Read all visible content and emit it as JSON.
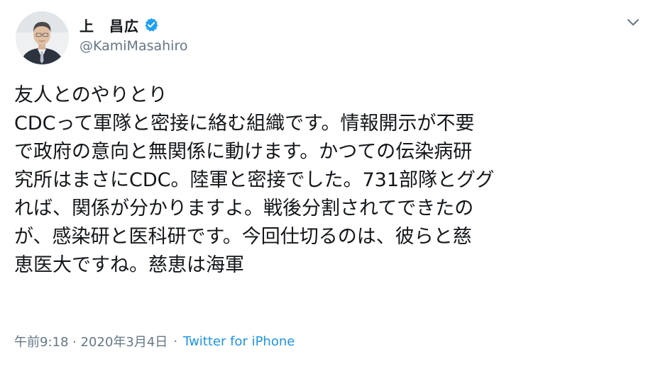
{
  "author": {
    "display_name": "上　昌広",
    "handle": "@KamiMasahiro",
    "verified": true
  },
  "tweet": {
    "lines": [
      "友人とのやりとり",
      "CDCって軍隊と密接に絡む組織です。情報開示が不要",
      "で政府の意向と無関係に動けます。かつての伝染病研",
      "究所はまさにCDC。陸軍と密接でした。731部隊とググ",
      "れば、関係が分かりますよ。戦後分割されてできたの",
      "が、感染研と医科研です。今回仕切るのは、彼らと慈",
      "恵医大ですね。慈恵は海軍"
    ]
  },
  "meta": {
    "timestamp": "午前9:18 · 2020年3月4日",
    "separator": "·",
    "source": "Twitter for iPhone"
  },
  "icons": {
    "verified_badge": "verified-badge-icon",
    "more_menu": "chevron-down-icon"
  },
  "colors": {
    "text_primary": "#14171a",
    "text_secondary": "#657786",
    "link": "#1b95e0",
    "verified": "#1da1f2"
  }
}
